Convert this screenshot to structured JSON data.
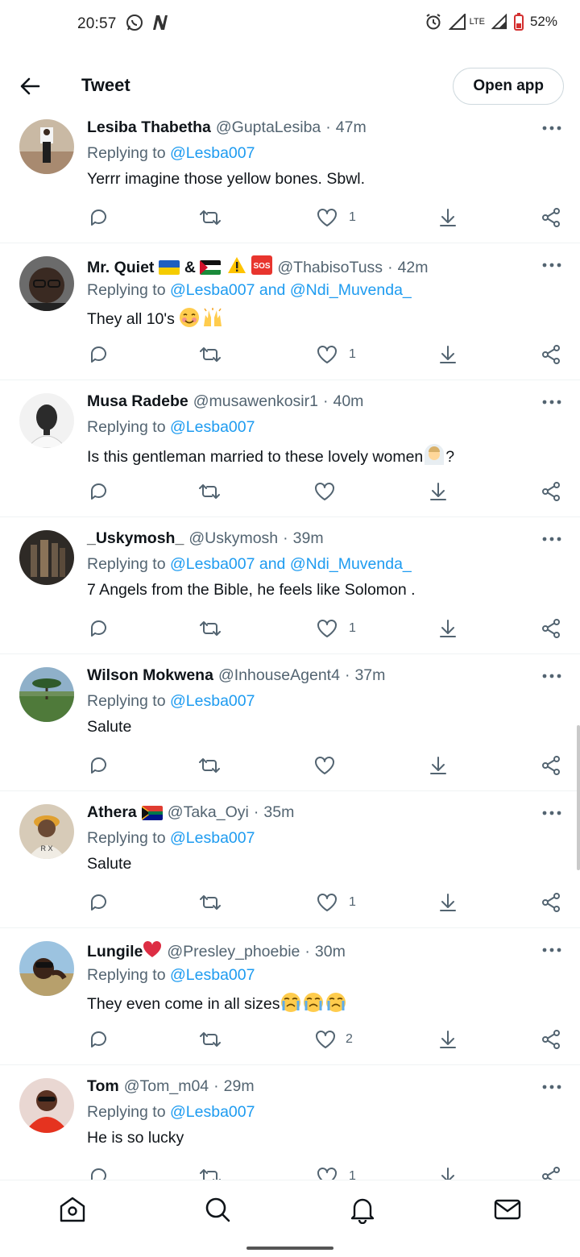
{
  "status_bar": {
    "time": "20:57",
    "network": "LTE",
    "battery": "52%"
  },
  "header": {
    "title": "Tweet",
    "open_app_label": "Open app"
  },
  "colors": {
    "link": "#1d9bf0",
    "secondary_text": "#536471",
    "primary_text": "#0f1419",
    "divider": "#eff3f4"
  },
  "tweets": [
    {
      "name": "Lesiba Thabetha",
      "handle": "@GuptaLesiba",
      "time": "47m",
      "replying_prefix": "Replying to ",
      "replying_to": "@Lesba007",
      "text": "Yerrr imagine those yellow bones. Sbwl.",
      "likes": "1"
    },
    {
      "name": "Mr. Quiet",
      "name_suffix_mid": " & ",
      "handle": "@ThabisoTuss",
      "time": "42m",
      "replying_prefix": "Replying to ",
      "replying_to": "@Lesba007 and @Ndi_Muvenda_",
      "text": "They all 10's ",
      "likes": "1"
    },
    {
      "name": "Musa Radebe",
      "handle": "@musawenkosir1",
      "time": "40m",
      "replying_prefix": "Replying to ",
      "replying_to": "@Lesba007",
      "text": "Is this gentleman married to these lovely women",
      "text_suffix": "?",
      "likes": ""
    },
    {
      "name": "_Uskymosh_",
      "handle": "@Uskymosh",
      "time": "39m",
      "replying_prefix": "Replying to ",
      "replying_to": "@Lesba007 and @Ndi_Muvenda_",
      "text": "7 Angels from the Bible, he feels like Solomon .",
      "likes": "1"
    },
    {
      "name": "Wilson Mokwena",
      "handle": "@InhouseAgent4",
      "time": "37m",
      "replying_prefix": "Replying to ",
      "replying_to": "@Lesba007",
      "text": "Salute",
      "likes": ""
    },
    {
      "name": "Athera",
      "handle": "@Taka_Oyi",
      "time": "35m",
      "replying_prefix": "Replying to ",
      "replying_to": "@Lesba007",
      "text": "Salute",
      "likes": "1"
    },
    {
      "name": "Lungile",
      "handle": "@Presley_phoebie",
      "time": "30m",
      "replying_prefix": "Replying to ",
      "replying_to": "@Lesba007",
      "text": "They even come in all sizes",
      "likes": "2"
    },
    {
      "name": "Tom",
      "handle": "@Tom_m04",
      "time": "29m",
      "replying_prefix": "Replying to ",
      "replying_to": "@Lesba007",
      "text": "He is so lucky",
      "likes": "1"
    }
  ],
  "separator_dot": "·",
  "bottom_nav": [
    "home-icon",
    "search-icon",
    "notifications-icon",
    "messages-icon"
  ]
}
